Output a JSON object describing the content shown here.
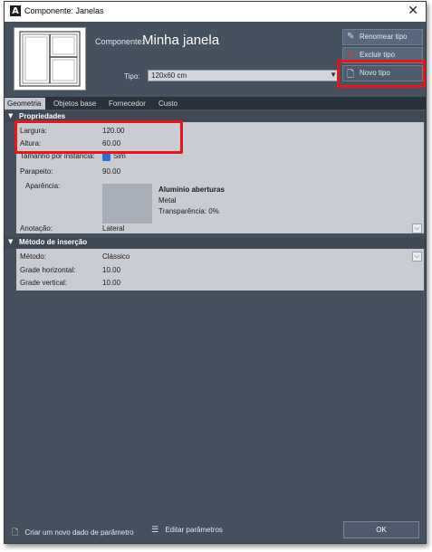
{
  "window": {
    "title": "Componente: Janelas",
    "logo": "A"
  },
  "header": {
    "component_label": "Componente:",
    "component_name": "Minha janela",
    "type_label": "Tipo:",
    "type_value": "120x60 cm",
    "buttons": {
      "rename": "Renomear tipo",
      "delete": "Excluir tipo",
      "new": "Novo tipo"
    }
  },
  "tabs": [
    {
      "label": "Geometria",
      "active": true
    },
    {
      "label": "Objetos base",
      "active": false
    },
    {
      "label": "Fornecedor",
      "active": false
    },
    {
      "label": "Custo",
      "active": false
    }
  ],
  "properties": {
    "section_title": "Propriedades",
    "largura_label": "Largura:",
    "largura_value": "120.00",
    "altura_label": "Altura:",
    "altura_value": "60.00",
    "tamanho_label": "Tamanho por instância:",
    "tamanho_value": "Sim",
    "parapeito_label": "Parapeito:",
    "parapeito_value": "90.00",
    "aparencia_label": "Aparência:",
    "material_name": "Alumínio aberturas",
    "material_type": "Metal",
    "material_transparency": "Transparência: 0%",
    "anotacao_label": "Anotação:",
    "anotacao_value": "Lateral"
  },
  "insertion": {
    "section_title": "Método de inserção",
    "metodo_label": "Método:",
    "metodo_value": "Clássico",
    "grade_h_label": "Grade horizontal:",
    "grade_h_value": "10.00",
    "grade_v_label": "Grade vertical:",
    "grade_v_value": "10.00"
  },
  "footer": {
    "create_param": "Criar um novo dado de parâmetro",
    "edit_params": "Editar parâmetros",
    "ok": "OK"
  },
  "colors": {
    "highlight": "#e8151b",
    "dialog_bg": "#44505e",
    "panel_bg": "#c9cdd3"
  }
}
